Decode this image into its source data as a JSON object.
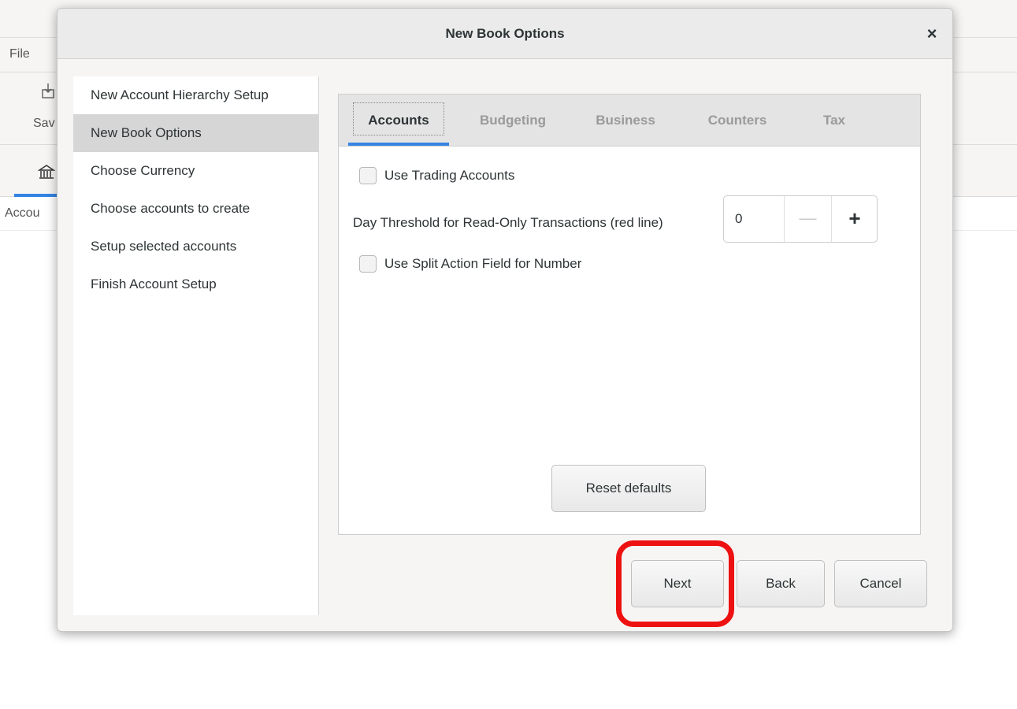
{
  "background_app": {
    "menu_file": "File",
    "toolbar_save": "Sav",
    "tab_accounts": "Accou"
  },
  "dialog": {
    "title": "New Book Options",
    "close_glyph": "×"
  },
  "sidebar": {
    "items": [
      {
        "label": "New Account Hierarchy Setup",
        "active": false
      },
      {
        "label": "New Book Options",
        "active": true
      },
      {
        "label": "Choose Currency",
        "active": false
      },
      {
        "label": "Choose accounts to create",
        "active": false
      },
      {
        "label": "Setup selected accounts",
        "active": false
      },
      {
        "label": "Finish Account Setup",
        "active": false
      }
    ]
  },
  "tabs": [
    {
      "label": "Accounts",
      "active": true
    },
    {
      "label": "Budgeting",
      "active": false
    },
    {
      "label": "Business",
      "active": false
    },
    {
      "label": "Counters",
      "active": false
    },
    {
      "label": "Tax",
      "active": false
    }
  ],
  "accounts_tab": {
    "use_trading_accounts": {
      "label": "Use Trading Accounts",
      "checked": false
    },
    "day_threshold": {
      "label": "Day Threshold for Read-Only Transactions (red line)",
      "value": "0",
      "minus_glyph": "—",
      "plus_glyph": "+"
    },
    "use_split_action": {
      "label": "Use Split Action Field for Number",
      "checked": false
    },
    "reset_defaults_label": "Reset defaults"
  },
  "footer": {
    "next_label": "Next",
    "back_label": "Back",
    "cancel_label": "Cancel"
  },
  "colors": {
    "accent": "#3584e4",
    "highlight": "#ee1111"
  }
}
